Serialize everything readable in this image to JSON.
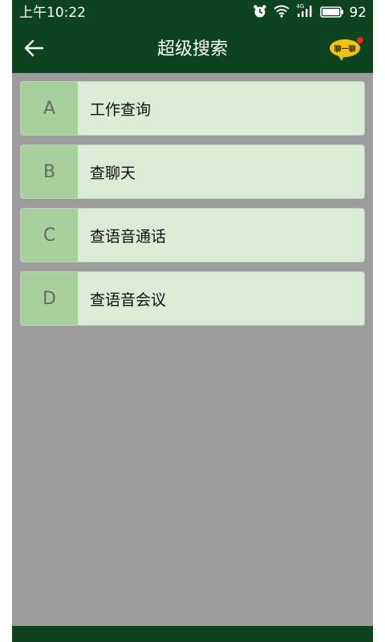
{
  "status_bar": {
    "time": "上午10:22",
    "network_label": "4G",
    "battery_level": "92",
    "icons": [
      "alarm-icon",
      "wifi-icon",
      "signal-icon",
      "battery-icon"
    ]
  },
  "header": {
    "title": "超级搜索",
    "chat_badge_text": "聊一聊",
    "back_icon": "arrow-left-icon"
  },
  "menu": {
    "items": [
      {
        "letter": "A",
        "label": "工作查询"
      },
      {
        "letter": "B",
        "label": "查聊天"
      },
      {
        "letter": "C",
        "label": "查语音通话"
      },
      {
        "letter": "D",
        "label": "查语音会议"
      }
    ]
  },
  "colors": {
    "header_bg": "#0c4420",
    "content_bg": "#9c9c9c",
    "item_bg": "#daebd6",
    "letter_bg": "#a8cf9c",
    "chat_badge": "#f3c312",
    "notification_dot": "#e8262a"
  }
}
